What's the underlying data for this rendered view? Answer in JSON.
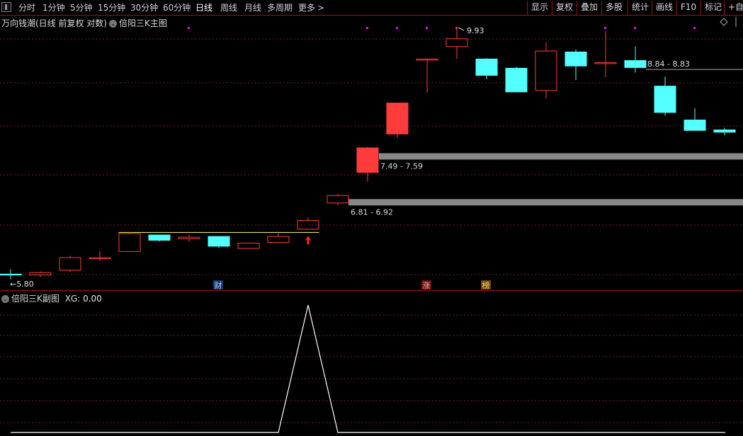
{
  "toolbar": {
    "periods": [
      {
        "label": "分时",
        "active": false
      },
      {
        "label": "1分钟",
        "active": false
      },
      {
        "label": "5分钟",
        "active": false
      },
      {
        "label": "15分钟",
        "active": false
      },
      {
        "label": "30分钟",
        "active": false
      },
      {
        "label": "60分钟",
        "active": false
      },
      {
        "label": "日线",
        "active": true
      },
      {
        "label": "周线",
        "active": false
      },
      {
        "label": "月线",
        "active": false
      },
      {
        "label": "多周期",
        "active": false
      },
      {
        "label": "更多",
        "active": false
      }
    ],
    "more_arrow": ">",
    "right_items": [
      "显示",
      "复权",
      "叠加",
      "多股",
      "统计",
      "画线",
      "F10",
      "标记",
      "+自选"
    ]
  },
  "main_chart": {
    "stock_title": "万向钱潮(日线 前复权 对数)",
    "indicator_name": "倍阳三K主图",
    "price_labels": {
      "low": "5.80",
      "high": "9.93",
      "zone1": "6.81 - 6.92",
      "zone2": "7.49 - 7.59",
      "zone3": "8.84 - 8.83"
    },
    "event_badges": [
      "财",
      "涨",
      "榜"
    ],
    "candles": [
      {
        "o": 5.87,
        "h": 5.93,
        "l": 5.8,
        "c": 5.85
      },
      {
        "o": 5.86,
        "h": 5.9,
        "l": 5.83,
        "c": 5.89
      },
      {
        "o": 5.92,
        "h": 6.1,
        "l": 5.89,
        "c": 6.08
      },
      {
        "o": 6.08,
        "h": 6.16,
        "l": 6.03,
        "c": 6.08
      },
      {
        "o": 6.16,
        "h": 6.41,
        "l": 6.16,
        "c": 6.4
      },
      {
        "o": 6.38,
        "h": 6.38,
        "l": 6.29,
        "c": 6.3
      },
      {
        "o": 6.33,
        "h": 6.38,
        "l": 6.28,
        "c": 6.35
      },
      {
        "o": 6.36,
        "h": 6.36,
        "l": 6.2,
        "c": 6.22
      },
      {
        "o": 6.2,
        "h": 6.27,
        "l": 6.2,
        "c": 6.27
      },
      {
        "o": 6.28,
        "h": 6.4,
        "l": 6.28,
        "c": 6.36
      },
      {
        "o": 6.46,
        "h": 6.62,
        "l": 6.46,
        "c": 6.58
      },
      {
        "o": 6.83,
        "h": 6.96,
        "l": 6.79,
        "c": 6.94
      },
      {
        "o": 7.28,
        "h": 7.69,
        "l": 7.14,
        "c": 7.68
      },
      {
        "o": 7.9,
        "h": 8.45,
        "l": 7.84,
        "c": 8.45
      },
      {
        "o": 9.28,
        "h": 9.28,
        "l": 8.63,
        "c": 9.28
      },
      {
        "o": 9.53,
        "h": 9.93,
        "l": 9.28,
        "c": 9.69
      },
      {
        "o": 9.28,
        "h": 9.29,
        "l": 8.88,
        "c": 8.95
      },
      {
        "o": 9.1,
        "h": 9.12,
        "l": 8.64,
        "c": 8.64
      },
      {
        "o": 8.68,
        "h": 9.61,
        "l": 8.53,
        "c": 9.44
      },
      {
        "o": 9.42,
        "h": 9.46,
        "l": 8.87,
        "c": 9.13
      },
      {
        "o": 9.19,
        "h": 9.84,
        "l": 8.92,
        "c": 9.21
      },
      {
        "o": 9.25,
        "h": 9.52,
        "l": 9.01,
        "c": 9.1
      },
      {
        "o": 8.76,
        "h": 8.93,
        "l": 8.22,
        "c": 8.27
      },
      {
        "o": 8.15,
        "h": 8.35,
        "l": 7.96,
        "c": 7.96
      },
      {
        "o": 7.98,
        "h": 8.01,
        "l": 7.88,
        "c": 7.93
      }
    ]
  },
  "sub_chart": {
    "indicator_name": "倍阳三K副图",
    "xg_label": "XG: 0.00",
    "xg_values": [
      0,
      0,
      0,
      0,
      0,
      0,
      0,
      0,
      0,
      0,
      1,
      0,
      0,
      0,
      0,
      0,
      0,
      0,
      0,
      0,
      0,
      0,
      0,
      0,
      0
    ]
  },
  "colors": {
    "up": "#ff3b3b",
    "down": "#54ffff",
    "gridline": "#7a1f1f",
    "zone": "#888888",
    "marker": "#ff00ff",
    "signal": "#ffff66",
    "xg_line": "#ffffff"
  }
}
